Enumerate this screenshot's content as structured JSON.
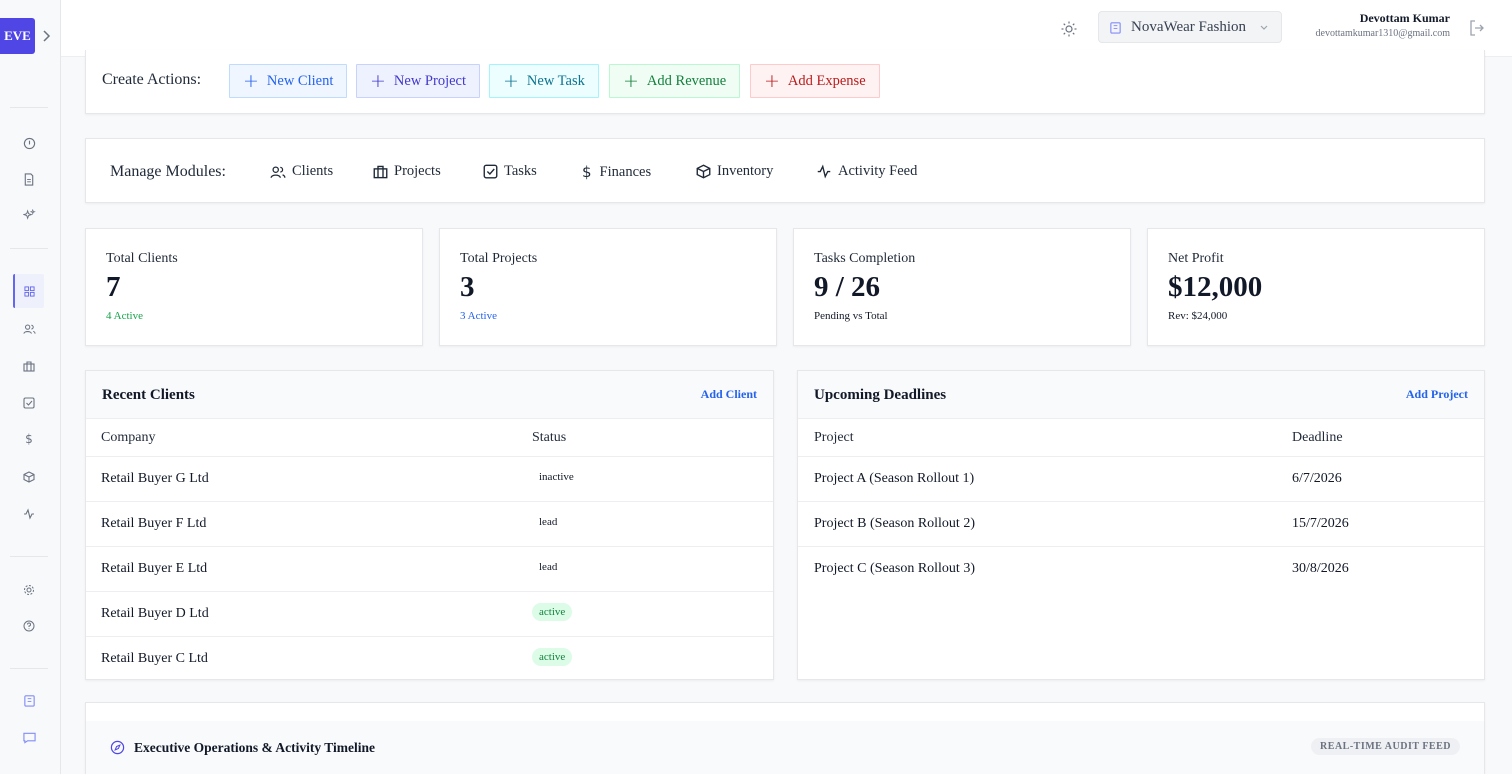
{
  "app": {
    "logo_text": "EVE"
  },
  "header": {
    "organization": "NovaWear Fashion",
    "user_name": "Devottam Kumar",
    "user_email": "devottamkumar1310@gmail.com"
  },
  "sidebar": {
    "icons": [
      "info-icon",
      "document-icon",
      "sparkle-icon",
      "dashboard-icon",
      "users-icon",
      "briefcase-icon",
      "check-square-icon",
      "dollar-icon",
      "box-icon",
      "activity-icon",
      "settings-icon",
      "help-icon",
      "building-icon",
      "chat-icon"
    ],
    "active": "dashboard-icon"
  },
  "create_actions": {
    "label": "Create Actions:",
    "buttons": [
      {
        "label": "New Client",
        "color": "#2563eb",
        "bg": "#eff6ff",
        "border": "#bfdbfe"
      },
      {
        "label": "New Project",
        "color": "#4338ca",
        "bg": "#eef2ff",
        "border": "#c7d2fe"
      },
      {
        "label": "New Task",
        "color": "#0e7490",
        "bg": "#ecfeff",
        "border": "#a5f3fc"
      },
      {
        "label": "Add Revenue",
        "color": "#15803d",
        "bg": "#f0fdf4",
        "border": "#bbf7d0"
      },
      {
        "label": "Add Expense",
        "color": "#b91c1c",
        "bg": "#fef2f2",
        "border": "#fecaca"
      }
    ]
  },
  "modules": {
    "label": "Manage Modules:",
    "items": [
      {
        "label": "Clients",
        "icon": "users-icon"
      },
      {
        "label": "Projects",
        "icon": "briefcase-icon"
      },
      {
        "label": "Tasks",
        "icon": "check-square-icon"
      },
      {
        "label": "Finances",
        "icon": "dollar-icon"
      },
      {
        "label": "Inventory",
        "icon": "box-icon"
      },
      {
        "label": "Activity Feed",
        "icon": "activity-icon"
      }
    ]
  },
  "stats": [
    {
      "title": "Total Clients",
      "value": "7",
      "sub": "4 Active",
      "sub_color": "#16a34a"
    },
    {
      "title": "Total Projects",
      "value": "3",
      "sub": "3 Active",
      "sub_color": "#2563eb"
    },
    {
      "title": "Tasks Completion",
      "value": "9 / 26",
      "sub": "Pending vs Total",
      "sub_color": "#111827"
    },
    {
      "title": "Net Profit",
      "value": "$12,000",
      "sub": "Rev: $24,000",
      "sub_color": "#111827"
    }
  ],
  "recent_clients": {
    "title": "Recent Clients",
    "action": "Add Client",
    "columns": [
      "Company",
      "Status"
    ],
    "rows": [
      {
        "company": "Retail Buyer G Ltd",
        "status": "inactive"
      },
      {
        "company": "Retail Buyer F Ltd",
        "status": "lead"
      },
      {
        "company": "Retail Buyer E Ltd",
        "status": "lead"
      },
      {
        "company": "Retail Buyer D Ltd",
        "status": "active"
      },
      {
        "company": "Retail Buyer C Ltd",
        "status": "active"
      }
    ]
  },
  "deadlines": {
    "title": "Upcoming Deadlines",
    "action": "Add Project",
    "columns": [
      "Project",
      "Deadline"
    ],
    "rows": [
      {
        "project": "Project A (Season Rollout 1)",
        "deadline": "6/7/2026"
      },
      {
        "project": "Project B (Season Rollout 2)",
        "deadline": "15/7/2026"
      },
      {
        "project": "Project C (Season Rollout 3)",
        "deadline": "30/8/2026"
      }
    ]
  },
  "timeline": {
    "title": "Executive Operations & Activity Timeline",
    "badge": "REAL-TIME AUDIT FEED"
  }
}
